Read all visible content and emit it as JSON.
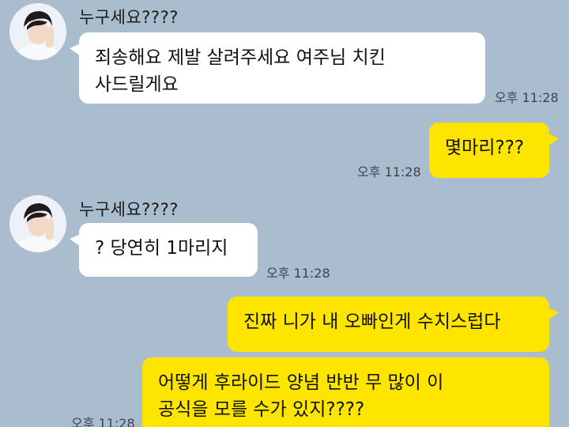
{
  "messages": [
    {
      "sender": "누구세요????",
      "text": "죄송해요 제발 살려주세요 여주님 치킨\n사드릴게요",
      "time": "오후 11:28"
    },
    {
      "text": "몇마리???",
      "time": "오후 11:28"
    },
    {
      "sender": "누구세요????",
      "text": "? 당연히 1마리지",
      "time": "오후 11:28"
    },
    {
      "text": "진짜 니가 내 오빠인게 수치스럽다"
    },
    {
      "text": "어떻게 후라이드 양념 반반 무 많이 이\n공식을 모를 수가 있지????",
      "time": "오후 11:28"
    }
  ],
  "colors": {
    "background": "#a9bdce",
    "incoming_bubble": "#ffffff",
    "outgoing_bubble": "#fee500"
  }
}
